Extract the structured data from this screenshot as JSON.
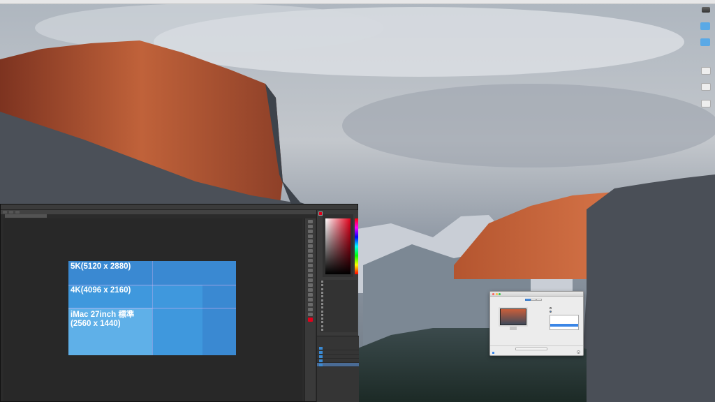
{
  "menubar": {
    "items": [
      "",
      "",
      "",
      "",
      "",
      ""
    ],
    "right_items": [
      "",
      "",
      ""
    ]
  },
  "desktop": {
    "icons": [
      {
        "name": "drive-icon",
        "label": ""
      },
      {
        "name": "folder-icon",
        "label": ""
      },
      {
        "name": "folder-icon",
        "label": ""
      },
      {
        "name": "document-icon",
        "label": ""
      },
      {
        "name": "document-icon",
        "label": ""
      },
      {
        "name": "document-icon",
        "label": ""
      }
    ]
  },
  "photoshop": {
    "window_title": "",
    "doc_tab": "",
    "option_items": [
      "",
      "",
      ""
    ],
    "canvas": {
      "labels": {
        "k5": "5K(5120 x 2880)",
        "k4": "4K(4096 x 2160)",
        "imac_line1": "iMac 27inch 標準",
        "imac_line2": "(2560 x 1440)"
      },
      "colors": {
        "k5": "#3a89d2",
        "k4": "#3f98dd",
        "imac": "#5fb0e8"
      }
    },
    "history_rows": [
      "",
      "",
      "",
      "",
      "",
      "",
      "",
      "",
      "",
      "",
      "",
      "",
      "",
      ""
    ],
    "layers": [
      "",
      "",
      "",
      "",
      ""
    ]
  },
  "displays_window": {
    "title": "",
    "tabs": [
      "",
      "",
      ""
    ],
    "resolution_options": [
      "",
      "",
      "",
      "",
      ""
    ],
    "texts": [
      "",
      "",
      "",
      ""
    ]
  }
}
